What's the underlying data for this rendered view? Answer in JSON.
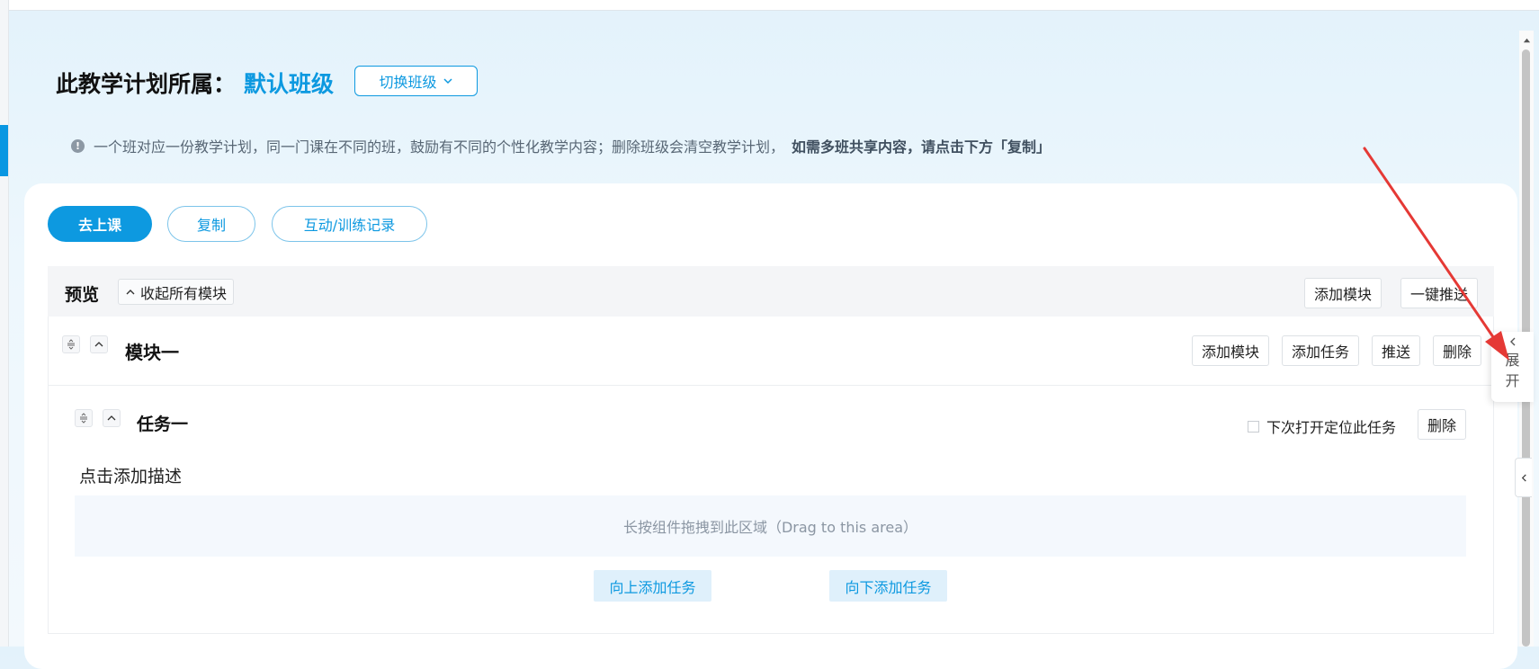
{
  "header": {
    "title": "此教学计划所属：",
    "class_name": "默认班级",
    "switch_label": "切换班级"
  },
  "notice": {
    "icon": "!",
    "text": "一个班对应一份教学计划，同一门课在不同的班，鼓励有不同的个性化教学内容；删除班级会清空教学计划，",
    "highlight": "如需多班共享内容，请点击下方「复制」"
  },
  "actions": {
    "go_class": "去上课",
    "copy": "复制",
    "records": "互动/训练记录"
  },
  "preview": {
    "title": "预览",
    "collapse_all": "收起所有模块",
    "add_module": "添加模块",
    "push_all": "一键推送"
  },
  "module": {
    "title": "模块一",
    "add_module": "添加模块",
    "add_task": "添加任务",
    "push": "推送",
    "delete": "删除"
  },
  "task": {
    "title": "任务一",
    "locate_label": "下次打开定位此任务",
    "locate_checked": false,
    "delete": "删除",
    "description_placeholder": "点击添加描述",
    "dropzone": "长按组件拖拽到此区域（Drag to this area）",
    "add_above": "向上添加任务",
    "add_below": "向下添加任务"
  },
  "side": {
    "expand_line1": "展",
    "expand_line2": "开"
  },
  "colors": {
    "accent": "#0d99e0",
    "annotation_arrow": "#e53935"
  }
}
